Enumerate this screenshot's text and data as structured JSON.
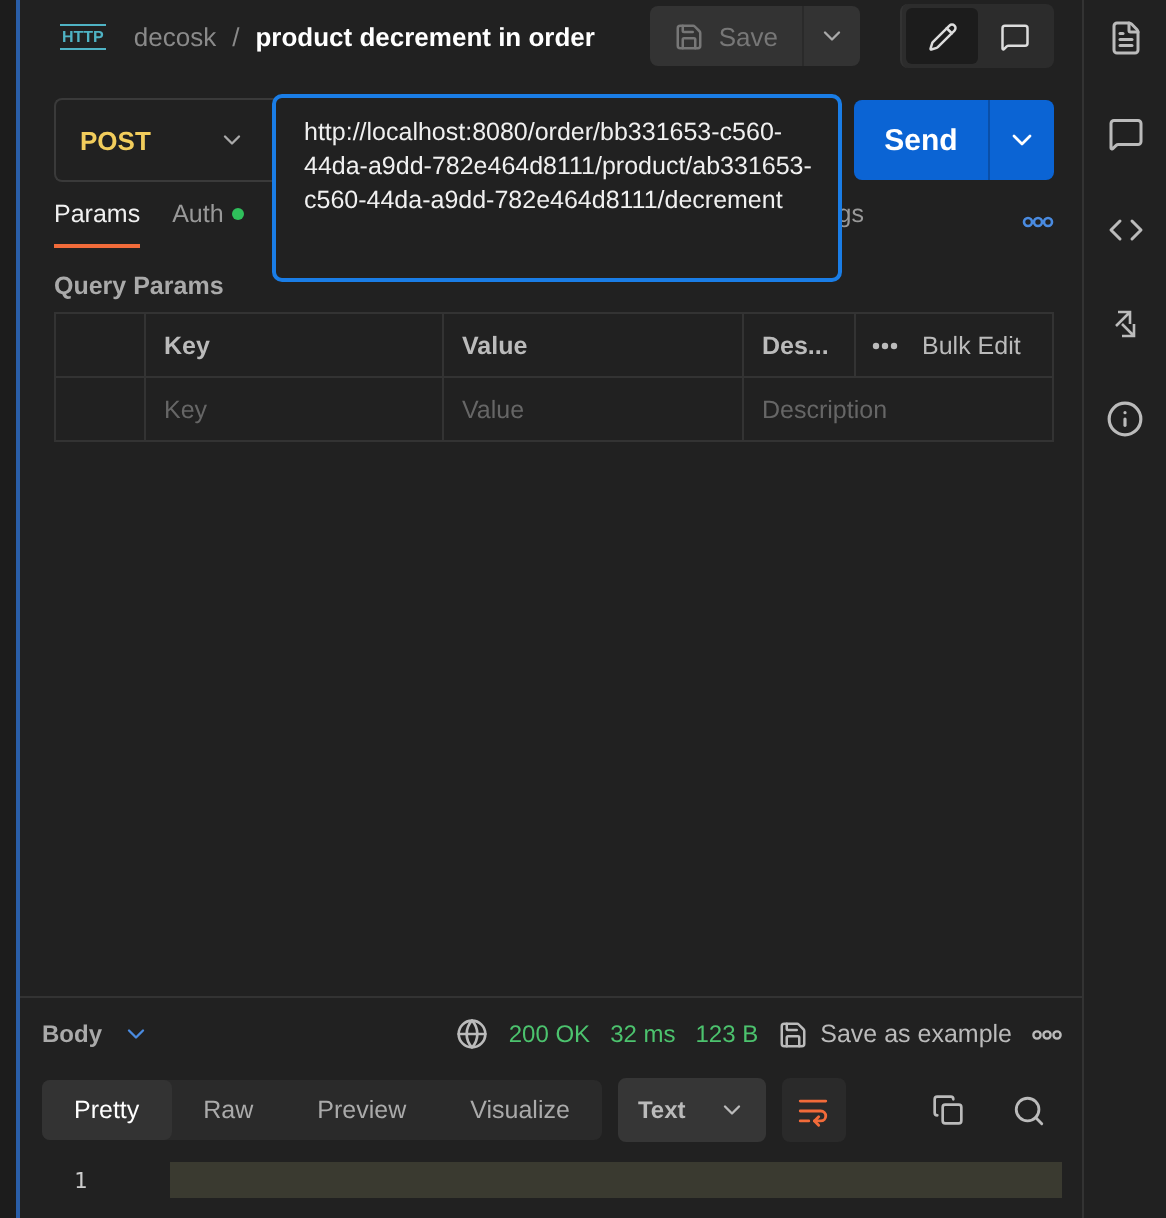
{
  "header": {
    "badge": "HTTP",
    "collection": "decosk",
    "separator": "/",
    "title": "product decrement in order",
    "save": "Save",
    "save_disabled": true
  },
  "request": {
    "method": "POST",
    "url": "http://localhost:8080/order/bb331653-c560-44da-a9dd-782e464d8111/product/ab331653-c560-44da-a9dd-782e464d8111/decrement",
    "send": "Send"
  },
  "tabs": [
    {
      "label": "Params",
      "selected": true,
      "indicator": false
    },
    {
      "label": "Auth",
      "selected": false,
      "indicator": true
    },
    {
      "label": "gs",
      "selected": false,
      "indicator": false
    }
  ],
  "query_params": {
    "title": "Query Params",
    "columns": [
      "Key",
      "Value",
      "Des..."
    ],
    "bulk_edit": "Bulk Edit",
    "placeholders": [
      "Key",
      "Value",
      "Description"
    ]
  },
  "response": {
    "section": "Body",
    "status": "200 OK",
    "time": "32 ms",
    "size": "123 B",
    "save": "Save as example",
    "view_tabs": [
      {
        "label": "Pretty",
        "selected": true
      },
      {
        "label": "Raw",
        "selected": false
      },
      {
        "label": "Preview",
        "selected": false
      },
      {
        "label": "Visualize",
        "selected": false
      }
    ],
    "format": "Text",
    "line_numbers": [
      "1"
    ]
  }
}
